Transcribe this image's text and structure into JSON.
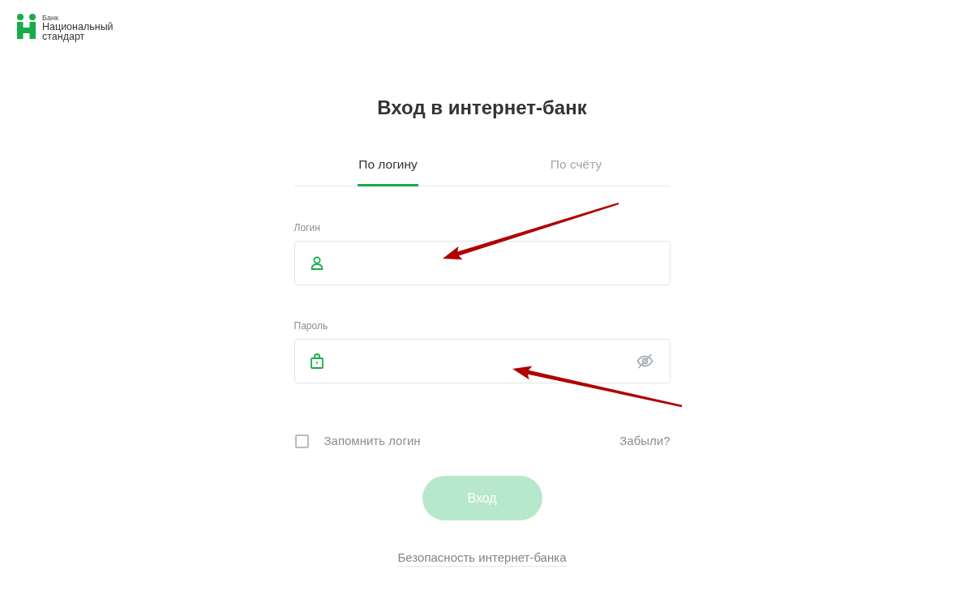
{
  "logo": {
    "caption": "Банк",
    "name_lines": [
      "Национальный",
      "стандарт"
    ]
  },
  "title": "Вход в интернет-банк",
  "tabs": [
    {
      "label": "По логину",
      "selected": true
    },
    {
      "label": "По счёту",
      "selected": false
    }
  ],
  "fields": [
    {
      "kind": "login",
      "label": "Логин"
    },
    {
      "kind": "password",
      "label": "Пароль",
      "masked": true
    }
  ],
  "remember": {
    "label": "Запомнить логин",
    "checked": false
  },
  "forgot_link": "Забыли?",
  "submit": {
    "label": "Вход",
    "disabled": true
  },
  "security_link": "Безопасность интернет-банка"
}
